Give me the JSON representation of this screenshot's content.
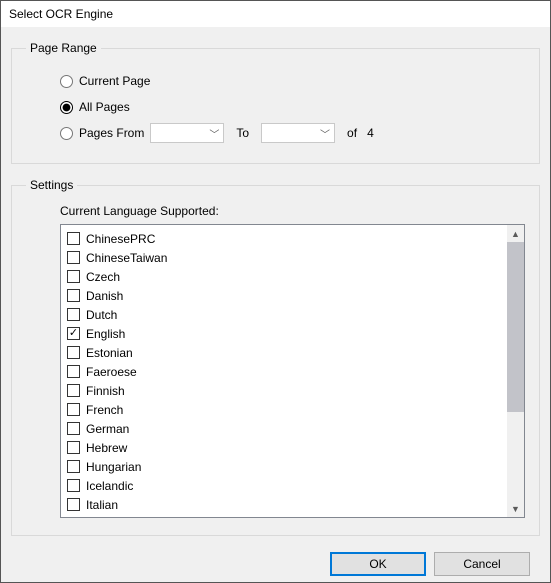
{
  "window": {
    "title": "Select OCR Engine"
  },
  "pageRange": {
    "legend": "Page Range",
    "current_label": "Current Page",
    "all_label": "All Pages",
    "from_label": "Pages From",
    "to_label": "To",
    "of_label": "of",
    "total_pages": "4",
    "selected": "all"
  },
  "settings": {
    "legend": "Settings",
    "lang_label": "Current Language Supported:",
    "languages": [
      {
        "label": "ChinesePRC",
        "checked": false
      },
      {
        "label": "ChineseTaiwan",
        "checked": false
      },
      {
        "label": "Czech",
        "checked": false
      },
      {
        "label": "Danish",
        "checked": false
      },
      {
        "label": "Dutch",
        "checked": false
      },
      {
        "label": "English",
        "checked": true
      },
      {
        "label": "Estonian",
        "checked": false
      },
      {
        "label": "Faeroese",
        "checked": false
      },
      {
        "label": "Finnish",
        "checked": false
      },
      {
        "label": "French",
        "checked": false
      },
      {
        "label": "German",
        "checked": false
      },
      {
        "label": "Hebrew",
        "checked": false
      },
      {
        "label": "Hungarian",
        "checked": false
      },
      {
        "label": "Icelandic",
        "checked": false
      },
      {
        "label": "Italian",
        "checked": false
      }
    ]
  },
  "buttons": {
    "ok": "OK",
    "cancel": "Cancel"
  }
}
